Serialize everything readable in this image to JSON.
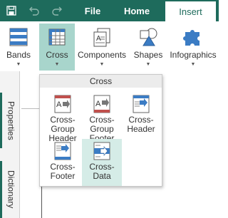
{
  "tabs": {
    "file": "File",
    "home": "Home",
    "insert": "Insert"
  },
  "ribbon": {
    "bands": "Bands",
    "cross": "Cross",
    "components": "Components",
    "shapes": "Shapes",
    "infographics": "Infographics"
  },
  "side_tabs": {
    "properties": "Properties",
    "dictionary": "Dictionary"
  },
  "dropdown": {
    "title": "Cross",
    "items": [
      {
        "label": "Cross-\nGroup\nHeader"
      },
      {
        "label": "Cross-\nGroup\nFooter"
      },
      {
        "label": "Cross-\nHeader"
      },
      {
        "label": "Cross-\nFooter"
      },
      {
        "label": "Cross-\nData"
      }
    ]
  },
  "colors": {
    "brand": "#1e6b5c",
    "active_button": "#a8d5cc",
    "icon_blue": "#3b7cc4",
    "icon_red": "#c0504d"
  }
}
